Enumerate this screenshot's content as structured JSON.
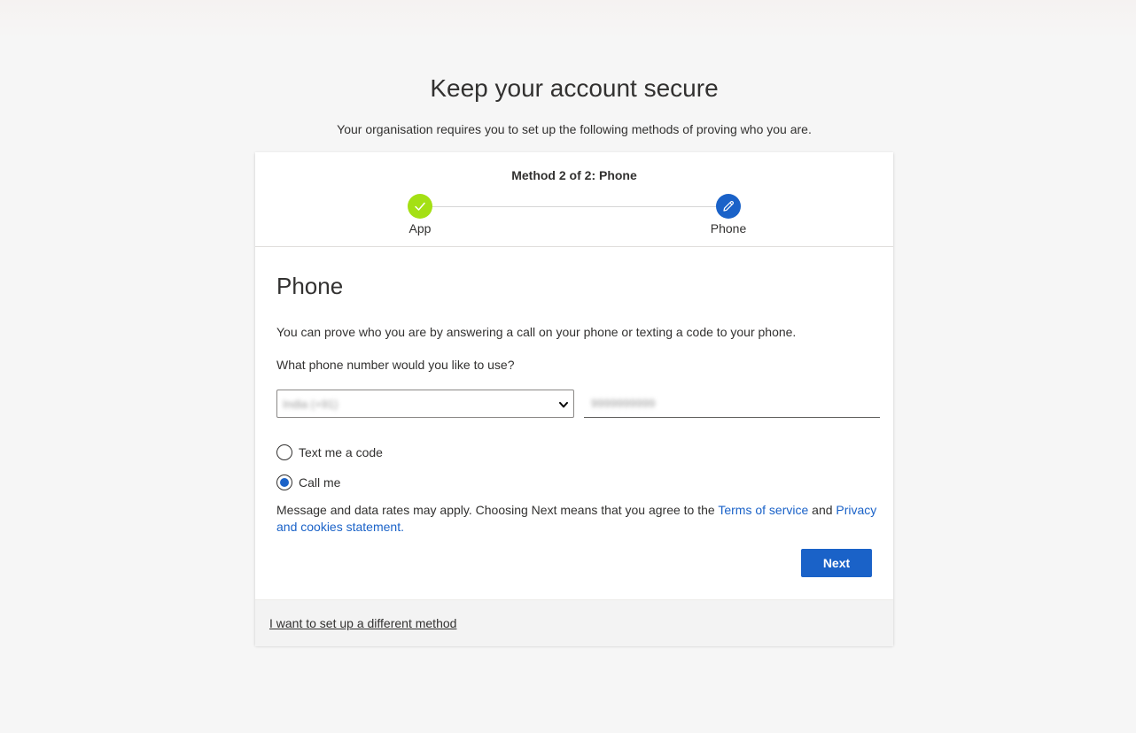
{
  "page": {
    "title": "Keep your account secure",
    "subtitle": "Your organisation requires you to set up the following methods of proving who you are."
  },
  "progress": {
    "title": "Method 2 of 2: Phone",
    "steps": [
      {
        "label": "App",
        "state": "completed",
        "icon": "checkmark-icon"
      },
      {
        "label": "Phone",
        "state": "current",
        "icon": "pencil-icon"
      }
    ]
  },
  "form": {
    "heading": "Phone",
    "description": "You can prove who you are by answering a call on your phone or texting a code to your phone.",
    "question": "What phone number would you like to use?",
    "country_select": {
      "value": "India (+91)",
      "obscured": true
    },
    "phone_input": {
      "value": "9999999999",
      "obscured": true
    },
    "options": [
      {
        "label": "Text me a code",
        "checked": false
      },
      {
        "label": "Call me",
        "checked": true
      }
    ],
    "disclaimer": {
      "prefix": "Message and data rates may apply. Choosing Next means that you agree to the ",
      "terms_link": "Terms of service",
      "middle": " and ",
      "privacy_link": "Privacy and cookies statement.",
      "suffix": ""
    },
    "next_label": "Next"
  },
  "footer": {
    "alternate_link": "I want to set up a different method"
  },
  "colors": {
    "accent": "#1a62c8",
    "step_complete": "#a4e014",
    "background": "#f6f6f6"
  }
}
